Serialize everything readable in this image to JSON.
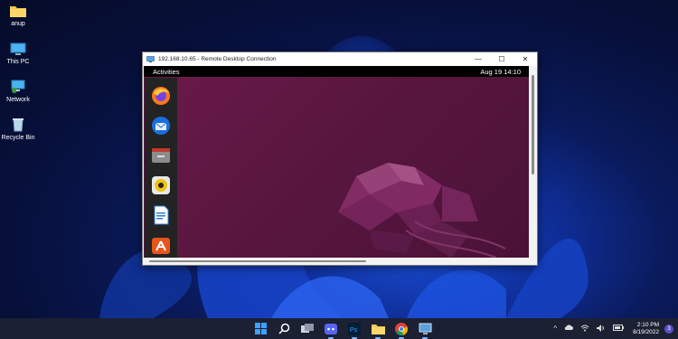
{
  "desktop": {
    "icons": [
      {
        "label": "anup",
        "icon": "folder-icon"
      },
      {
        "label": "This PC",
        "icon": "monitor-icon"
      },
      {
        "label": "Network",
        "icon": "network-icon"
      },
      {
        "label": "Recycle Bin",
        "icon": "recycle-bin-icon"
      }
    ]
  },
  "rdp": {
    "title": "192.168.10.65 - Remote Desktop Connection",
    "controls": {
      "minimize": "—",
      "maximize": "☐",
      "close": "✕"
    }
  },
  "ubuntu": {
    "activities": "Activities",
    "datetime": "Aug 19  14:10",
    "dock": [
      "firefox-icon",
      "thunderbird-icon",
      "files-icon",
      "rhythmbox-icon",
      "libreoffice-writer-icon",
      "software-center-icon"
    ]
  },
  "taskbar": {
    "apps": [
      "windows-start-icon",
      "search-icon",
      "task-view-icon",
      "discord-icon",
      "photoshop-icon",
      "file-explorer-icon",
      "chrome-icon",
      "remote-desktop-icon"
    ],
    "photoshop_label": "Ps",
    "tray": {
      "chevron": "^",
      "time": "2:10 PM",
      "date": "8/19/2022",
      "notifications": "3"
    }
  },
  "colors": {
    "accent": "#1b4fd8",
    "ubuntu_wallpaper": "#5a1740",
    "taskbar": "#1c2033"
  }
}
